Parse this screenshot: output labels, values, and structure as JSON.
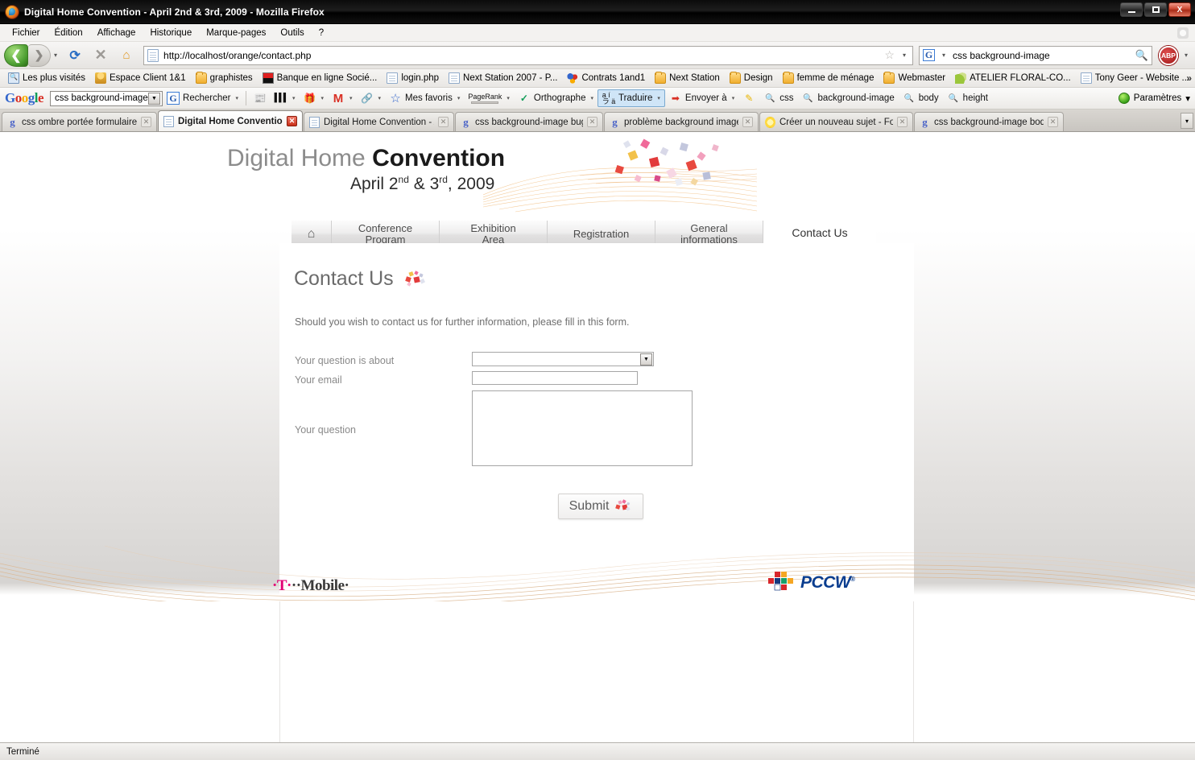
{
  "window": {
    "title": "Digital Home Convention - April 2nd & 3rd, 2009 - Mozilla Firefox",
    "minimize_label": "Minimize",
    "maximize_label": "Maximize",
    "close_label": "X"
  },
  "menubar": {
    "items": [
      {
        "label": "Fichier"
      },
      {
        "label": "Édition"
      },
      {
        "label": "Affichage"
      },
      {
        "label": "Historique"
      },
      {
        "label": "Marque-pages"
      },
      {
        "label": "Outils"
      },
      {
        "label": "?"
      }
    ]
  },
  "navbar": {
    "back_glyph": "❮",
    "forward_glyph": "❯",
    "dropdown_glyph": "▾",
    "reload_glyph": "⟳",
    "stop_glyph": "✕",
    "home_glyph": "⌂",
    "url": "http://localhost/orange/contact.php",
    "star_glyph": "☆",
    "search_value": "css background-image",
    "search_engine": "G",
    "magnifier_glyph": "🔍",
    "adblock_label": "ABP"
  },
  "bookmarks": {
    "items": [
      {
        "label": "Les plus visités",
        "icon": "bluepage-icon",
        "kind": "bluepage"
      },
      {
        "label": "Espace Client 1&1",
        "icon": "person-icon",
        "kind": "person"
      },
      {
        "label": "graphistes",
        "icon": "folder-icon",
        "kind": "folder"
      },
      {
        "label": "Banque en ligne Socié...",
        "icon": "redflag-icon",
        "kind": "redflag"
      },
      {
        "label": "login.php",
        "icon": "page-icon",
        "kind": "page"
      },
      {
        "label": "Next Station 2007 - P...",
        "icon": "page-icon",
        "kind": "page"
      },
      {
        "label": "Contrats 1and1",
        "icon": "dots-icon",
        "kind": "dots"
      },
      {
        "label": "Next Station",
        "icon": "folder-icon",
        "kind": "folder"
      },
      {
        "label": "Design",
        "icon": "folder-icon",
        "kind": "folder"
      },
      {
        "label": "femme de ménage",
        "icon": "folder-icon",
        "kind": "folder"
      },
      {
        "label": "Webmaster",
        "icon": "folder-icon",
        "kind": "folder"
      },
      {
        "label": "ATELIER FLORAL-CO...",
        "icon": "leaf-icon",
        "kind": "leaf"
      },
      {
        "label": "Tony Geer - Website ...",
        "icon": "page-icon",
        "kind": "page"
      }
    ],
    "overflow_glyph": "»"
  },
  "google_toolbar": {
    "logo_letters": [
      "G",
      "o",
      "o",
      "g",
      "l",
      "e"
    ],
    "search_value": "css background-image",
    "dropdown_glyph": "▼",
    "items": [
      {
        "label": "Rechercher",
        "icon": "google-g-icon",
        "glyph": "G",
        "caret": true
      },
      {
        "label": "",
        "icon": "news-icon",
        "glyph": "📰",
        "caret": false
      },
      {
        "label": "",
        "icon": "barcode-icon",
        "glyph": "▥",
        "caret": true
      },
      {
        "label": "",
        "icon": "bookmark-star-icon",
        "glyph": "🎁",
        "caret": true
      },
      {
        "label": "",
        "icon": "gmail-icon",
        "glyph": "M",
        "caret": true
      },
      {
        "label": "",
        "icon": "link-icon",
        "glyph": "🔗",
        "caret": true
      },
      {
        "label": "Mes favoris",
        "icon": "star-icon",
        "glyph": "☆",
        "caret": true
      },
      {
        "label": "PageRank",
        "icon": "pagerank-icon",
        "glyph": "",
        "caret": true
      },
      {
        "label": "Orthographe",
        "icon": "spellcheck-icon",
        "glyph": "✓",
        "caret": true
      },
      {
        "label": "Traduire",
        "icon": "translate-icon",
        "glyph": "文",
        "caret": true,
        "highlight": true
      },
      {
        "label": "Envoyer à",
        "icon": "send-to-icon",
        "glyph": "➡",
        "caret": true
      },
      {
        "label": "",
        "icon": "highlighter-icon",
        "glyph": "✎",
        "caret": false
      }
    ],
    "highlight_terms": [
      {
        "label": "css"
      },
      {
        "label": "background-image"
      },
      {
        "label": "body"
      },
      {
        "label": "height"
      }
    ],
    "settings_label": "Paramètres",
    "find_glyph": "🔍"
  },
  "tabs": {
    "items": [
      {
        "label": "css ombre portée formulaire in...",
        "favicon": "g8-icon",
        "kind": "g8",
        "active": false
      },
      {
        "label": "Digital Home Convention ...",
        "favicon": "doc-icon",
        "kind": "doc",
        "active": true
      },
      {
        "label": "Digital Home Convention - Apri...",
        "favicon": "doc-icon",
        "kind": "doc",
        "active": false
      },
      {
        "label": "css background-image bug fire...",
        "favicon": "g8-icon",
        "kind": "g8",
        "active": false
      },
      {
        "label": "problème background image a...",
        "favicon": "g8-icon",
        "kind": "g8",
        "active": false
      },
      {
        "label": "Créer un nouveau sujet - Foru...",
        "favicon": "sun-icon",
        "kind": "sun",
        "active": false
      },
      {
        "label": "css background-image body h...",
        "favicon": "g8-icon",
        "kind": "g8",
        "active": false
      }
    ],
    "close_glyph": "✕",
    "list_glyph": "▾"
  },
  "page": {
    "brand_light": "Digital Home ",
    "brand_bold": "Convention",
    "brand_date": "April 2nd & 3rd, 2009",
    "brand_date_day1": "April 2",
    "brand_date_sup1": "nd",
    "brand_date_mid": " & 3",
    "brand_date_sup2": "rd",
    "brand_date_end": ", 2009",
    "nav": [
      {
        "label": "",
        "icon": "home-icon",
        "glyph": "⌂",
        "active": false,
        "home": true
      },
      {
        "label": "Conference\nProgram",
        "line1": "Conference",
        "line2": "Program",
        "active": false
      },
      {
        "label": "Exhibition\nArea",
        "line1": "Exhibition",
        "line2": "Area",
        "active": false
      },
      {
        "label": "Registration",
        "line1": "Registration",
        "line2": "",
        "active": false
      },
      {
        "label": "General\ninformations",
        "line1": "General",
        "line2": "informations",
        "active": false
      },
      {
        "label": "Contact Us",
        "line1": "Contact Us",
        "line2": "",
        "active": true
      }
    ],
    "heading": "Contact Us",
    "lead": "Should you wish to contact us for further information, please fill in this form.",
    "form": {
      "fields": [
        {
          "label": "Your question is about",
          "type": "select",
          "value": "",
          "options": []
        },
        {
          "label": "Your email",
          "type": "text",
          "value": "",
          "placeholder": ""
        },
        {
          "label": "Your question",
          "type": "textarea",
          "value": "",
          "placeholder": ""
        }
      ],
      "submit_label": "Submit"
    },
    "footer": {
      "sponsor1_name": "T··Mobile·",
      "sponsor1_t": "·T·",
      "sponsor1_rest": "··Mobile·",
      "sponsor2_name": "PCCW",
      "sponsor2_sup": "®"
    }
  },
  "statusbar": {
    "text": "Terminé"
  },
  "colors": {
    "accent_orange": "#f0ae2e",
    "tmobile_magenta": "#e20074",
    "pccw_blue": "#0a3d8f",
    "firefox_orange": "#ef8b22",
    "tab_highlight": "#cfe5f7"
  }
}
